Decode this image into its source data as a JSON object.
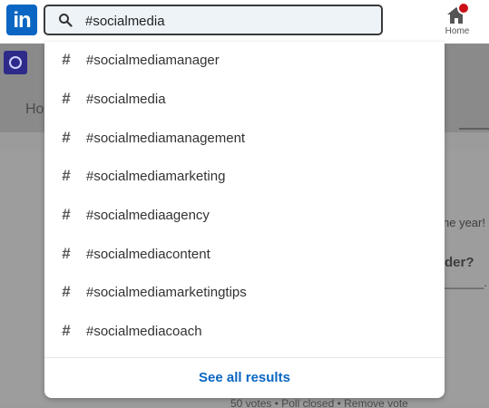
{
  "app": {
    "logo_text": "in",
    "brand_color": "#0a66c2"
  },
  "search": {
    "value": "#socialmedia",
    "placeholder": ""
  },
  "nav": {
    "home_label": "Home",
    "notification_color": "#cc1016"
  },
  "background": {
    "tab_fragment": "Ho",
    "snippet_year": "he year!",
    "snippet_der": "der?",
    "snippet_blank": "______.",
    "footer_text": "50 votes • Poll closed • Remove vote"
  },
  "suggestions": [
    {
      "icon": "hashtag-icon",
      "label": "#socialmediamanager"
    },
    {
      "icon": "hashtag-icon",
      "label": "#socialmedia"
    },
    {
      "icon": "hashtag-icon",
      "label": "#socialmediamanagement"
    },
    {
      "icon": "hashtag-icon",
      "label": "#socialmediamarketing"
    },
    {
      "icon": "hashtag-icon",
      "label": "#socialmediaagency"
    },
    {
      "icon": "hashtag-icon",
      "label": "#socialmediacontent"
    },
    {
      "icon": "hashtag-icon",
      "label": "#socialmediamarketingtips"
    },
    {
      "icon": "hashtag-icon",
      "label": "#socialmediacoach"
    }
  ],
  "see_all_label": "See all results"
}
